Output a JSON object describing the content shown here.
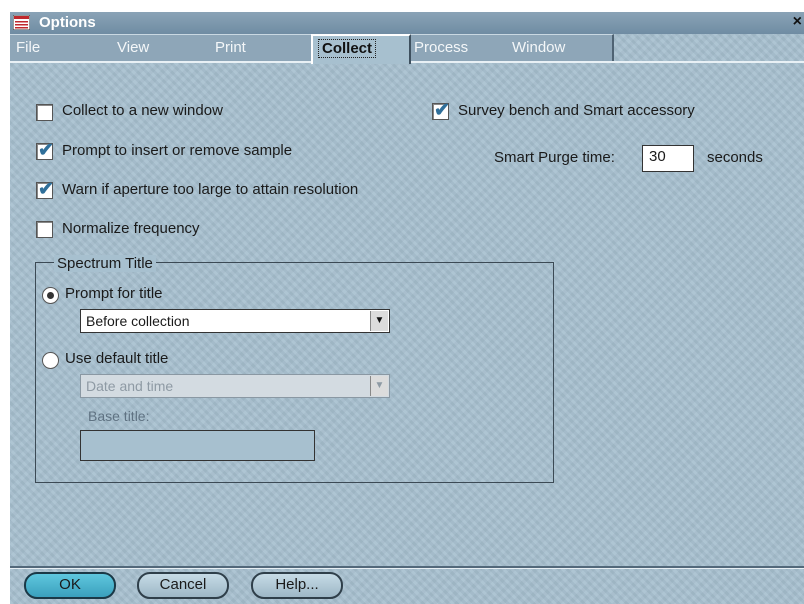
{
  "window": {
    "title": "Options",
    "close_label": "×"
  },
  "tabs": [
    {
      "label": "File",
      "active": false
    },
    {
      "label": "View",
      "active": false
    },
    {
      "label": "Print",
      "active": false
    },
    {
      "label": "Collect",
      "active": true
    },
    {
      "label": "Process",
      "active": false
    },
    {
      "label": "Window",
      "active": false
    }
  ],
  "options": {
    "collect_new_window": {
      "label": "Collect to a new window",
      "checked": false
    },
    "prompt_sample": {
      "label": "Prompt to insert or remove sample",
      "checked": true
    },
    "warn_aperture": {
      "label": "Warn if aperture too large to attain resolution",
      "checked": true
    },
    "normalize_frequency": {
      "label": "Normalize frequency",
      "checked": false
    },
    "survey_bench": {
      "label": "Survey bench and Smart accessory",
      "checked": true
    },
    "smart_purge_label": "Smart Purge time:",
    "smart_purge_value": "30",
    "smart_purge_units": "seconds"
  },
  "spectrum_title": {
    "legend": "Spectrum Title",
    "prompt_for_title": {
      "label": "Prompt for title",
      "selected": true
    },
    "prompt_select_value": "Before collection",
    "use_default_title": {
      "label": "Use default title",
      "selected": false
    },
    "default_select_value": "Date and time",
    "base_title_label": "Base title:",
    "base_title_value": ""
  },
  "buttons": {
    "ok": "OK",
    "cancel": "Cancel",
    "help": "Help..."
  },
  "colors": {
    "panel": "#a7c0cf",
    "check_mark": "#2f6f9a",
    "ok_button": "#3aa0bd"
  }
}
